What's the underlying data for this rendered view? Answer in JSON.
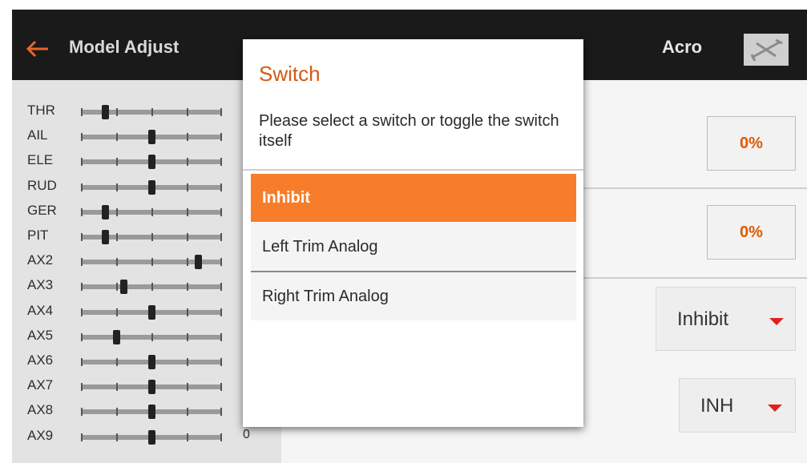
{
  "header": {
    "title": "Model Adjust",
    "mode": "Acro",
    "back_icon": "back-arrow-icon",
    "model_icon": "airplane-icon",
    "accent_color": "#e8642a"
  },
  "channels": [
    {
      "label": "THR",
      "value": "",
      "level": 0.17
    },
    {
      "label": "AIL",
      "value": "",
      "level": 0.5
    },
    {
      "label": "ELE",
      "value": "",
      "level": 0.5
    },
    {
      "label": "RUD",
      "value": "",
      "level": 0.5
    },
    {
      "label": "GER",
      "value": "",
      "level": 0.17
    },
    {
      "label": "PIT",
      "value": "",
      "level": 0.17
    },
    {
      "label": "AX2",
      "value": "",
      "level": 0.83
    },
    {
      "label": "AX3",
      "value": "",
      "level": 0.3
    },
    {
      "label": "AX4",
      "value": "",
      "level": 0.5
    },
    {
      "label": "AX5",
      "value": "",
      "level": 0.25
    },
    {
      "label": "AX6",
      "value": "",
      "level": 0.5
    },
    {
      "label": "AX7",
      "value": "",
      "level": 0.5
    },
    {
      "label": "AX8",
      "value": "",
      "level": 0.5
    },
    {
      "label": "AX9",
      "value": "0",
      "level": 0.5
    }
  ],
  "settings": {
    "value1": "0%",
    "value2": "0%",
    "switch_select": "Inhibit",
    "switch_position": "INH"
  },
  "dialog": {
    "title": "Switch",
    "message": "Please select a switch or toggle the switch itself",
    "options": [
      "Inhibit",
      "Left Trim Analog",
      "Right Trim Analog"
    ],
    "selected": "Inhibit",
    "selected_color": "#f77d2a",
    "title_color": "#d35a16"
  }
}
